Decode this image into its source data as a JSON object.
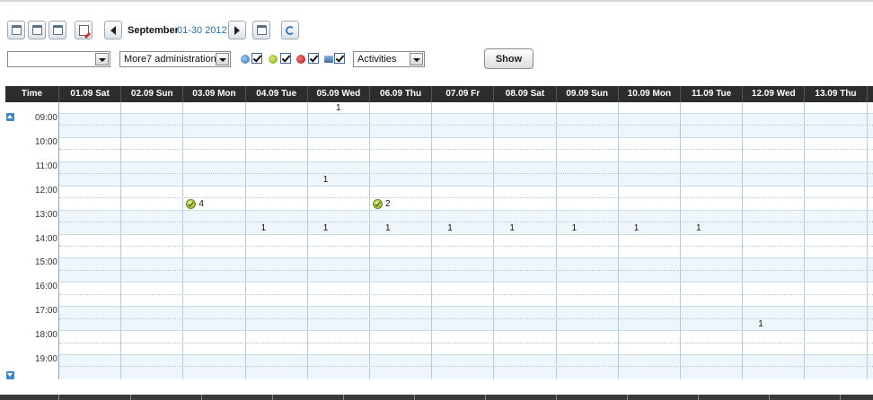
{
  "toolbar": {
    "month": "September",
    "range": "01-30 2012",
    "show_label": "Show"
  },
  "filters": {
    "first_select": "",
    "admin_select": "More7 administration",
    "type_select": "Activities",
    "toggles": [
      "planned",
      "done",
      "cancelled",
      "other"
    ]
  },
  "calendar": {
    "time_header": "Time",
    "days": [
      "01.09 Sat",
      "02.09 Sun",
      "03.09 Mon",
      "04.09 Tue",
      "05.09 Wed",
      "06.09 Thu",
      "07.09 Fr",
      "08.09 Sat",
      "09.09 Sun",
      "10.09 Mon",
      "11.09 Tue",
      "12.09 Wed",
      "13.09 Thu"
    ],
    "hours": [
      "09:00",
      "10:00",
      "11:00",
      "12:00",
      "13:00",
      "14:00",
      "15:00",
      "16:00",
      "17:00",
      "18:00",
      "19:00"
    ],
    "allday_count": "1",
    "events": [
      {
        "day": "05.09 Wed",
        "time": "11:00",
        "status": "cancelled",
        "count": "1"
      },
      {
        "day": "03.09 Mon",
        "time": "12:00",
        "status": "done",
        "count": "4"
      },
      {
        "day": "06.09 Thu",
        "time": "12:00",
        "status": "done",
        "count": "2"
      },
      {
        "day": "04.09 Tue",
        "time": "13:00",
        "status": "cancelled",
        "count": "1"
      },
      {
        "day": "05.09 Wed",
        "time": "13:00",
        "status": "cancelled",
        "count": "1"
      },
      {
        "day": "06.09 Thu",
        "time": "13:00",
        "status": "cancelled",
        "count": "1"
      },
      {
        "day": "07.09 Fr",
        "time": "13:00",
        "status": "cancelled",
        "count": "1"
      },
      {
        "day": "08.09 Sat",
        "time": "13:00",
        "status": "cancelled",
        "count": "1"
      },
      {
        "day": "09.09 Sun",
        "time": "13:00",
        "status": "cancelled",
        "count": "1"
      },
      {
        "day": "10.09 Mon",
        "time": "13:00",
        "status": "cancelled",
        "count": "1"
      },
      {
        "day": "11.09 Tue",
        "time": "13:00",
        "status": "cancelled",
        "count": "1"
      },
      {
        "day": "12.09 Wed",
        "time": "17:00",
        "status": "cancelled",
        "count": "1"
      }
    ]
  },
  "colors": {
    "header_bg": "#2d2d2d",
    "band_alt": "#eef6fb",
    "link": "#2f6ea3",
    "done": "#86a612",
    "cancelled": "#b01717"
  }
}
